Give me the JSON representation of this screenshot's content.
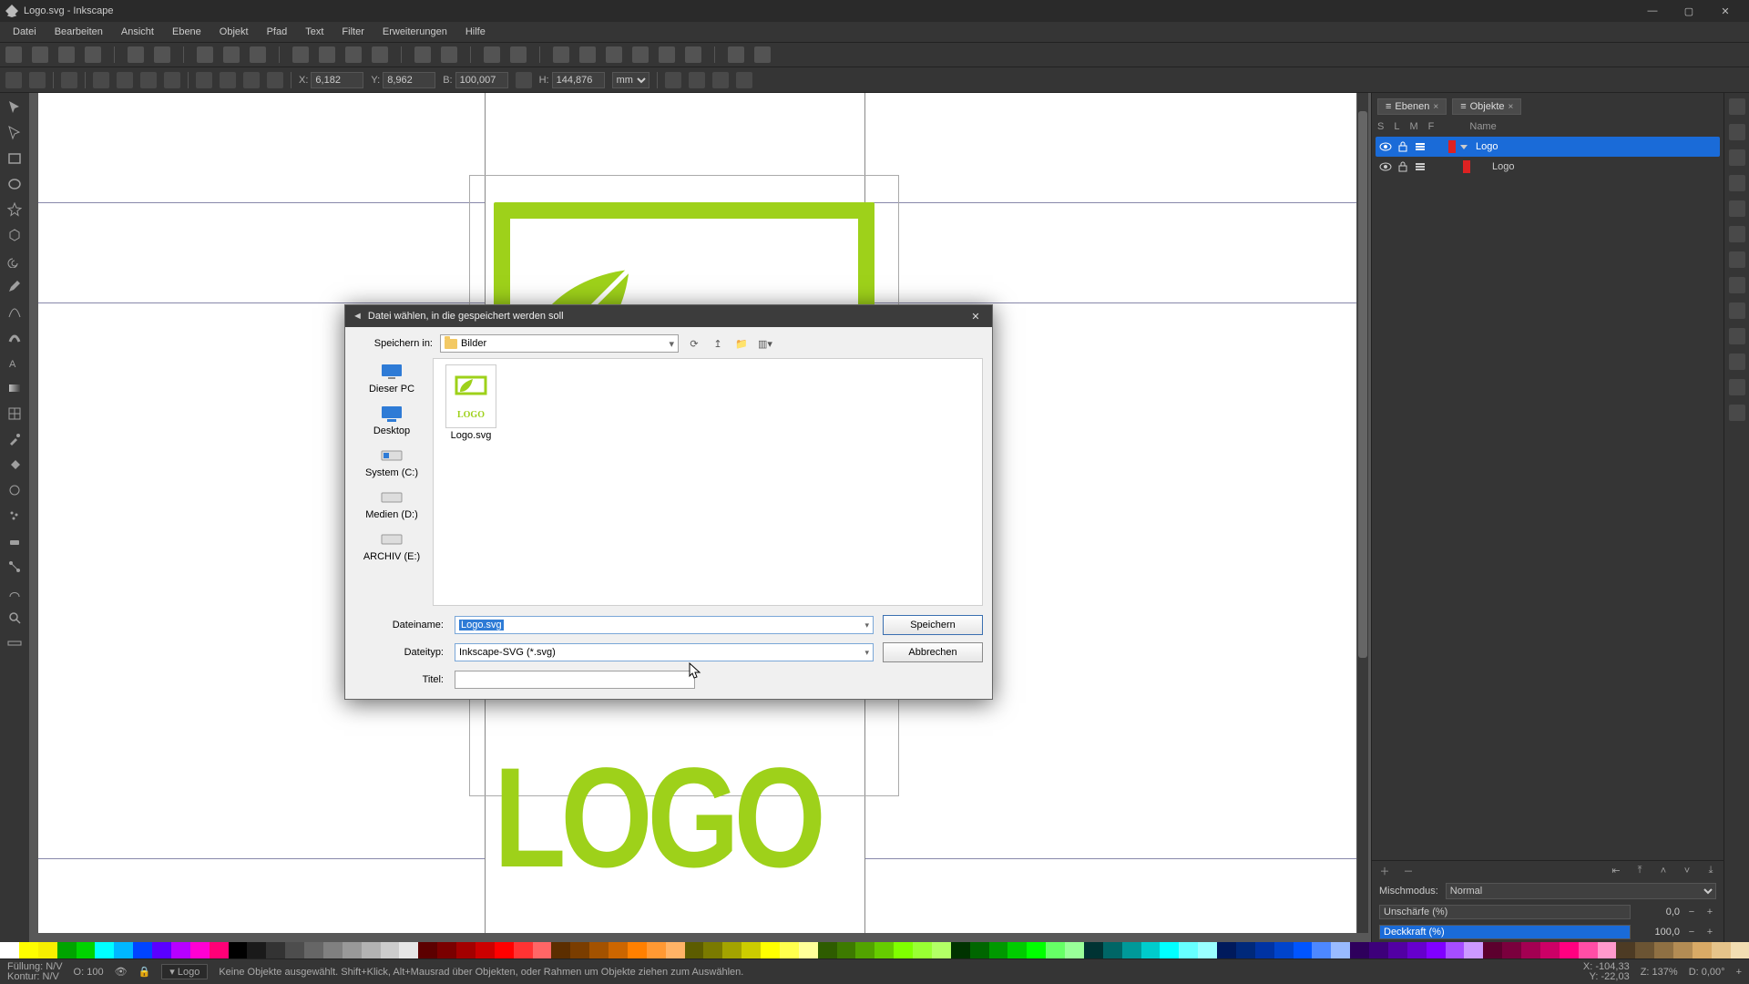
{
  "title": "Logo.svg - Inkscape",
  "menu": [
    "Datei",
    "Bearbeiten",
    "Ansicht",
    "Ebene",
    "Objekt",
    "Pfad",
    "Text",
    "Filter",
    "Erweiterungen",
    "Hilfe"
  ],
  "toolbar2": {
    "x_label": "X:",
    "x": "6,182",
    "y_label": "Y:",
    "y": "8,962",
    "w_label": "B:",
    "w": "100,007",
    "h_label": "H:",
    "h": "144,876",
    "unit": "mm"
  },
  "panels": {
    "layers_tab": "Ebenen",
    "objects_tab": "Objekte",
    "header": {
      "s": "S",
      "l": "L",
      "t": "M",
      "m": "F",
      "name": "Name"
    },
    "rows": [
      {
        "name": "Logo",
        "selected": true,
        "indent": 0,
        "expandable": true
      },
      {
        "name": "Logo",
        "selected": false,
        "indent": 1,
        "expandable": false
      }
    ],
    "blend_label": "Mischmodus:",
    "blend_value": "Normal",
    "blur_label": "Unschärfe (%)",
    "blur_value": "0,0",
    "opacity_label": "Deckkraft (%)",
    "opacity_value": "100,0"
  },
  "status": {
    "fill_label": "Füllung:",
    "fill_value": "N/V",
    "stroke_label": "Kontur:",
    "stroke_value": "N/V",
    "o_label": "O:",
    "o_value": "100",
    "layer": "Logo",
    "hint": "Keine Objekte ausgewählt. Shift+Klick, Alt+Mausrad über Objekten, oder Rahmen um Objekte ziehen zum Auswählen.",
    "x_label": "X:",
    "x": "-104,33",
    "y_label": "Y:",
    "y": "-22,03",
    "z_label": "Z:",
    "z": "137%",
    "d_label": "D:",
    "d": "0,00°"
  },
  "dialog": {
    "title": "Datei wählen, in die gespeichert werden soll",
    "save_in_label": "Speichern in:",
    "folder": "Bilder",
    "places": [
      "Dieser PC",
      "Desktop",
      "System (C:)",
      "Medien (D:)",
      "ARCHIV (E:)"
    ],
    "file_shown": "Logo.svg",
    "name_label": "Dateiname:",
    "name_value": "Logo.svg",
    "type_label": "Dateityp:",
    "type_value": "Inkscape-SVG (*.svg)",
    "title_label": "Titel:",
    "title_value": "",
    "save_btn": "Speichern",
    "cancel_btn": "Abbrechen"
  },
  "palette": [
    "#ffffff",
    "#fefd00",
    "#f7ef00",
    "#00a400",
    "#00d300",
    "#00ffff",
    "#00b7ff",
    "#0044ff",
    "#5a00ff",
    "#b700ff",
    "#ff00d3",
    "#ff0077",
    "#000000",
    "#1a1a1a",
    "#333333",
    "#4d4d4d",
    "#666666",
    "#808080",
    "#999999",
    "#b3b3b3",
    "#cccccc",
    "#e6e6e6",
    "#5c0000",
    "#7a0000",
    "#a30000",
    "#cc0000",
    "#ff0000",
    "#ff3333",
    "#ff6666",
    "#5c2e00",
    "#7a3d00",
    "#a35200",
    "#cc6600",
    "#ff8000",
    "#ff9933",
    "#ffb366",
    "#5c5c00",
    "#7a7a00",
    "#a3a300",
    "#cccc00",
    "#ffff00",
    "#ffff4d",
    "#ffff99",
    "#2e5c00",
    "#3d7a00",
    "#52a300",
    "#66cc00",
    "#80ff00",
    "#99ff33",
    "#b3ff66",
    "#003300",
    "#006600",
    "#009900",
    "#00cc00",
    "#00ff00",
    "#66ff66",
    "#99ff99",
    "#003333",
    "#006666",
    "#009999",
    "#00cccc",
    "#00ffff",
    "#66ffff",
    "#99ffff",
    "#001a5c",
    "#00297a",
    "#0033a3",
    "#0044cc",
    "#0055ff",
    "#4d88ff",
    "#99bbff",
    "#2e005c",
    "#3d007a",
    "#5200a3",
    "#6600cc",
    "#8000ff",
    "#a64dff",
    "#cc99ff",
    "#5c002e",
    "#7a003d",
    "#a30052",
    "#cc0066",
    "#ff0080",
    "#ff4da6",
    "#ff99cc",
    "#4d3b24",
    "#6b5433",
    "#8f7043",
    "#b38c54",
    "#d9aa66",
    "#e6c48a",
    "#f2deb3"
  ]
}
